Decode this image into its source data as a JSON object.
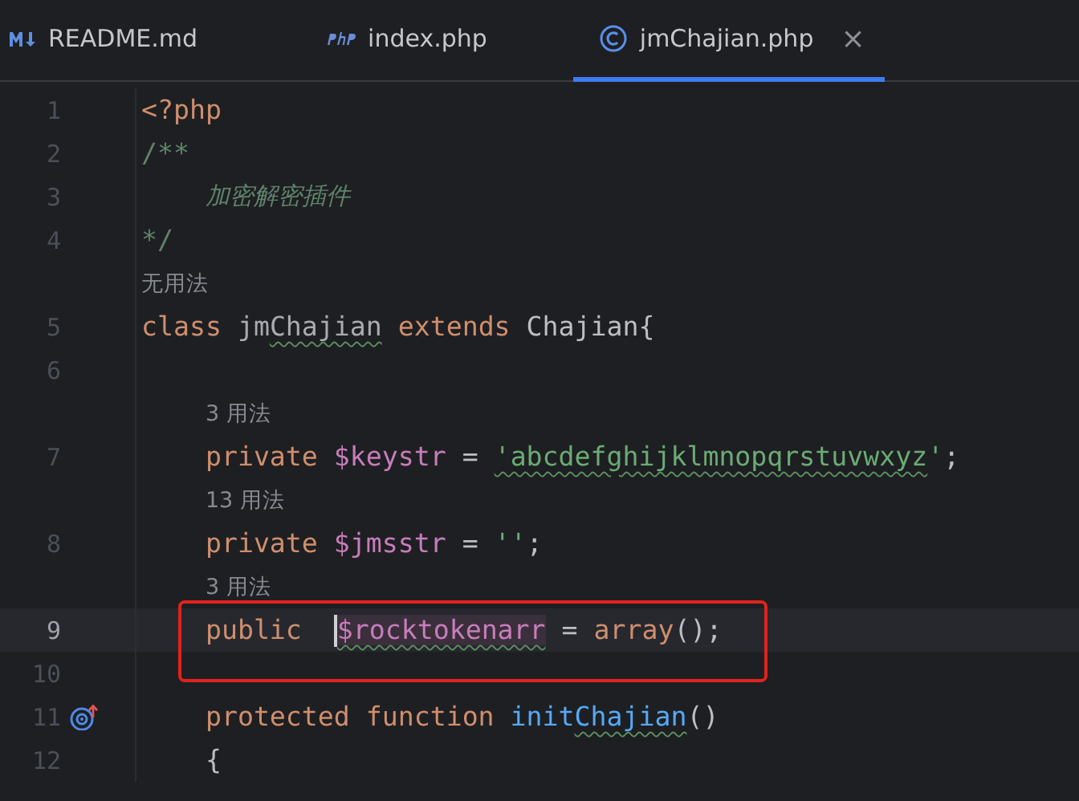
{
  "tabs": [
    {
      "kind": "markdown",
      "label": "README.md",
      "selected": false
    },
    {
      "kind": "php",
      "label": "index.php",
      "selected": false
    },
    {
      "kind": "class",
      "label": "jmChajian.php",
      "selected": true,
      "close": "×"
    }
  ],
  "editor": {
    "lines": [
      {
        "kind": "code",
        "number": "1",
        "current": false,
        "segments": [
          {
            "kind": "keyword",
            "text": "<?php"
          }
        ]
      },
      {
        "kind": "code",
        "number": "2",
        "current": false,
        "segments": [
          {
            "kind": "doc",
            "text": "/**"
          }
        ]
      },
      {
        "kind": "code",
        "number": "3",
        "current": false,
        "segments": [
          {
            "kind": "doctext",
            "text": "    加密解密插件"
          }
        ]
      },
      {
        "kind": "code",
        "number": "4",
        "current": false,
        "segments": [
          {
            "kind": "doc",
            "text": "*/"
          }
        ]
      },
      {
        "kind": "hint",
        "text": "无用法"
      },
      {
        "kind": "code",
        "number": "5",
        "current": false,
        "segments": [
          {
            "kind": "keyword",
            "text": "class "
          },
          {
            "kind": "dim",
            "text": "jm"
          },
          {
            "kind": "dim",
            "text": "Chajian",
            "typo": true
          },
          {
            "kind": "keyword",
            "text": " extends"
          },
          {
            "kind": "plain",
            "text": " Chajian{"
          }
        ]
      },
      {
        "kind": "code",
        "number": "6",
        "current": false
      },
      {
        "kind": "hint",
        "text": "3 用法"
      },
      {
        "kind": "code",
        "number": "7",
        "current": false,
        "segments": [
          {
            "kind": "keyword",
            "text": "    private "
          },
          {
            "kind": "variable",
            "text": "$keystr"
          },
          {
            "kind": "plain",
            "text": " = "
          },
          {
            "kind": "string",
            "text": "'abcdefghijklmnopqrstuvwxyz",
            "typo": true
          },
          {
            "kind": "string",
            "text": "'"
          },
          {
            "kind": "plain",
            "text": ";"
          }
        ]
      },
      {
        "kind": "hint",
        "text": "13 用法"
      },
      {
        "kind": "code",
        "number": "8",
        "current": false,
        "segments": [
          {
            "kind": "keyword",
            "text": "    private "
          },
          {
            "kind": "variable",
            "text": "$jmsstr"
          },
          {
            "kind": "plain",
            "text": " = "
          },
          {
            "kind": "string",
            "text": "''"
          },
          {
            "kind": "plain",
            "text": ";"
          }
        ]
      },
      {
        "kind": "hint",
        "text": "3 用法"
      },
      {
        "kind": "code",
        "number": "9",
        "current": true,
        "boxed": true,
        "segments": [
          {
            "kind": "keyword",
            "text": "    public  "
          },
          {
            "kind": "variable",
            "text": "$rocktokenarr",
            "typo": true,
            "marked": true,
            "caret": true
          },
          {
            "kind": "plain",
            "text": " = "
          },
          {
            "kind": "keyword",
            "text": "array"
          },
          {
            "kind": "plain",
            "text": "();"
          }
        ]
      },
      {
        "kind": "code",
        "number": "10",
        "current": false
      },
      {
        "kind": "code",
        "number": "11",
        "current": false,
        "gutter_marker": true,
        "segments": [
          {
            "kind": "keyword",
            "text": "    protected function "
          },
          {
            "kind": "function",
            "text": "init"
          },
          {
            "kind": "function",
            "text": "Chajian",
            "typo": true
          },
          {
            "kind": "plain",
            "text": "()"
          }
        ]
      },
      {
        "kind": "code",
        "number": "12",
        "current": false,
        "segments": [
          {
            "kind": "plain",
            "text": "    {"
          }
        ]
      }
    ]
  }
}
